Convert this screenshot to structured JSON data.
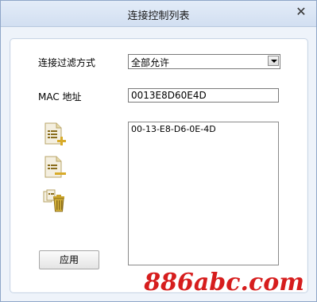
{
  "window": {
    "title": "连接控制列表"
  },
  "form": {
    "filter_label": "连接过滤方式",
    "filter_value": "全部允许",
    "mac_label": "MAC 地址",
    "mac_value": "0013E8D60E4D"
  },
  "mac_list": [
    "00-13-E8-D6-0E-4D"
  ],
  "buttons": {
    "apply": "应用"
  },
  "watermark": "886abc.com",
  "colors": {
    "watermark": "#d61d1d",
    "titlebar": "#d8e4f4",
    "icon_gold": "#c9a228"
  }
}
